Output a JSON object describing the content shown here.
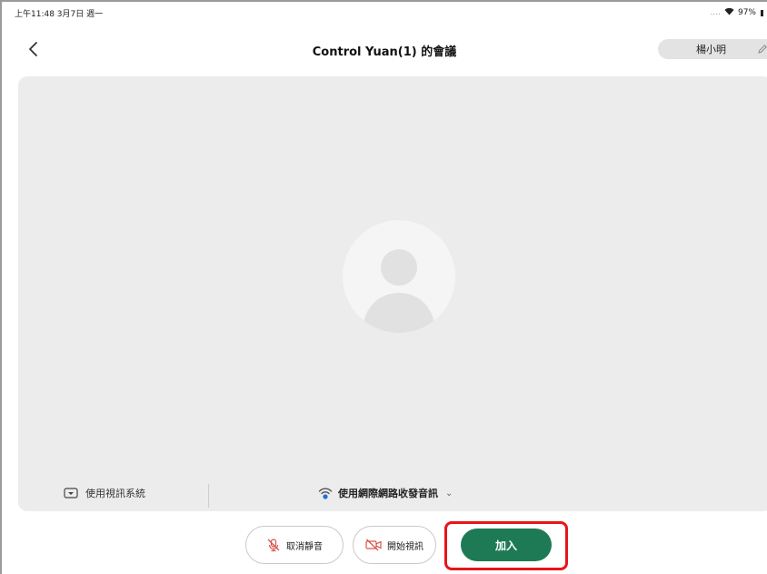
{
  "status_bar": {
    "time_date": "上午11:48  3月7日 週一",
    "battery": "97%",
    "signal_dots": "....",
    "wifi_icon": "wifi-icon"
  },
  "nav": {
    "title": "Control Yuan(1) 的會議",
    "user_name": "楊小明"
  },
  "audio_options": {
    "video_system_label": "使用視訊系統",
    "internet_audio_label": "使用網際網路收發音訊",
    "caret": "⌄"
  },
  "controls": {
    "mute_label": "取消靜音",
    "video_label": "開始視訊",
    "join_label": "加入"
  },
  "colors": {
    "join_button": "#1e7a55",
    "highlight": "#e8141b",
    "preview_bg": "#ececec",
    "mute_icon": "#d9534f",
    "wifi_blue": "#1e6fd9"
  }
}
